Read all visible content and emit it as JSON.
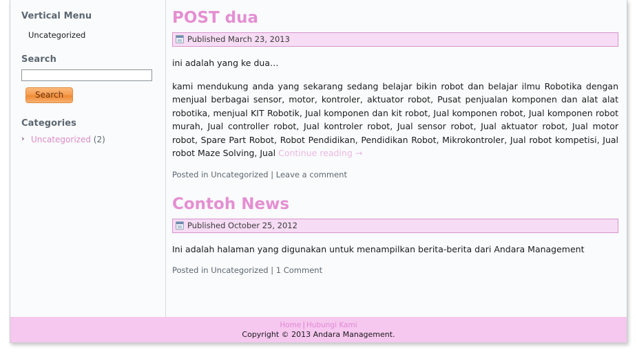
{
  "sidebar": {
    "vertical_menu": {
      "title": "Vertical Menu",
      "items": [
        {
          "label": "Uncategorized"
        }
      ]
    },
    "search": {
      "title": "Search",
      "value": "",
      "placeholder": "",
      "button_label": "Search"
    },
    "categories": {
      "title": "Categories",
      "items": [
        {
          "label": "Uncategorized",
          "count": "(2)",
          "arrow": "›"
        }
      ]
    }
  },
  "main": {
    "posts": [
      {
        "title": "POST dua",
        "date_label": "Published March 23, 2013",
        "intro": "ini adalah yang ke dua…",
        "body": "kami mendukung anda yang sekarang sedang belajar bikin robot dan belajar ilmu Robotika dengan menjual berbagai sensor, motor, kontroler, aktuator robot, Pusat penjualan komponen dan alat alat robotika, menjual KIT Robotik, Jual komponen dan kit robot, Jual komponen robot, Jual komponen robot murah, Jual controller robot, Jual kontroler robot, Jual sensor robot, Jual aktuator robot, Jual motor robot, Spare Part Robot, Robot Pendidikan, Pendidikan Robot, Mikrokontroler, Jual robot kompetisi, Jual robot Maze Solving, Jual ",
        "continue_label": "Continue reading →",
        "meta_prefix": "Posted in ",
        "meta_category": "Uncategorized",
        "meta_separator": " | ",
        "meta_comments": "Leave a comment"
      },
      {
        "title": "Contoh News",
        "date_label": "Published October 25, 2012",
        "body": "Ini adalah halaman yang digunakan untuk menampilkan berita-berita dari Andara Management",
        "meta_prefix": "Posted in ",
        "meta_category": "Uncategorized",
        "meta_separator": " | ",
        "meta_comments": "1 Comment"
      }
    ]
  },
  "footer": {
    "links": [
      {
        "label": "Home"
      },
      {
        "label": "Hubungi Kami"
      }
    ],
    "separator": "|",
    "copyright": "Copyright © 2013 Andara Management."
  },
  "colors": {
    "accent_pink": "#e48fd2",
    "date_bar_bg": "#f6dcf4",
    "date_bar_border": "#d793cf",
    "footer_bg": "#f6c7ef",
    "button_orange": "#ef8a33",
    "heading_gray": "#5b6670"
  }
}
